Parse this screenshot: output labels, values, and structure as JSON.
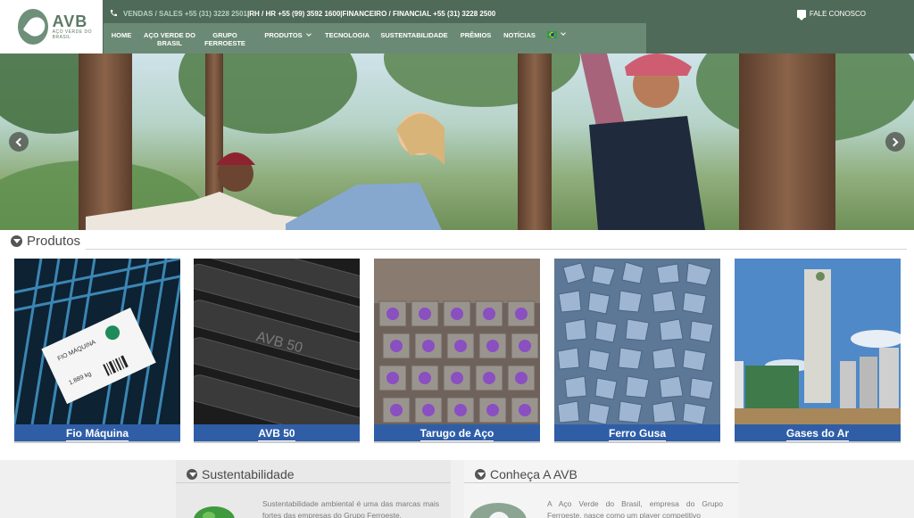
{
  "header": {
    "logo": {
      "name": "AVB",
      "subtitle": "AÇO VERDE DO BRASIL"
    },
    "contact_line": {
      "sales": "VENDAS / SALES +55 (31) 3228 2501",
      "sep1": " | ",
      "hr": "RH / HR +55 (99) 3592 1600",
      "sep2": " | ",
      "finance": "FINANCEIRO / FINANCIAL +55 (31) 3228 2500"
    },
    "contact_link": "FALE CONOSCO",
    "nav": [
      {
        "label": "HOME"
      },
      {
        "label": "AÇO VERDE DO BRASIL"
      },
      {
        "label": "GRUPO FERROESTE"
      },
      {
        "label": "PRODUTOS"
      },
      {
        "label": "TECNOLOGIA"
      },
      {
        "label": "SUSTENTABILIDADE"
      },
      {
        "label": "PRÊMIOS"
      },
      {
        "label": "NOTÍCIAS"
      }
    ],
    "language_flag": "brazil-flag"
  },
  "hero": {
    "prev_icon": "chevron-left-icon",
    "next_icon": "chevron-right-icon"
  },
  "products": {
    "title": "Produtos",
    "items": [
      {
        "label": "Fio Máquina",
        "tag_text": "FIO MÁQUINA",
        "tag_weight": "1.889 kg"
      },
      {
        "label": "AVB 50",
        "stamp": "AVB 50"
      },
      {
        "label": "Tarugo de Aço"
      },
      {
        "label": "Ferro Gusa"
      },
      {
        "label": "Gases do Ar"
      }
    ]
  },
  "sustainability": {
    "title": "Sustentabilidade",
    "text": "Sustentabilidade ambiental é uma das marcas mais fortes das empresas do Grupo Ferroeste."
  },
  "about": {
    "title": "Conheça A AVB",
    "text": "A Aço Verde do Brasil, empresa do Grupo Ferroeste, nasce como um player competitivo"
  },
  "colors": {
    "header_bg": "#4f6a58",
    "nav_bg": "#6b8a75",
    "label_bg": "#2f5ea7"
  }
}
